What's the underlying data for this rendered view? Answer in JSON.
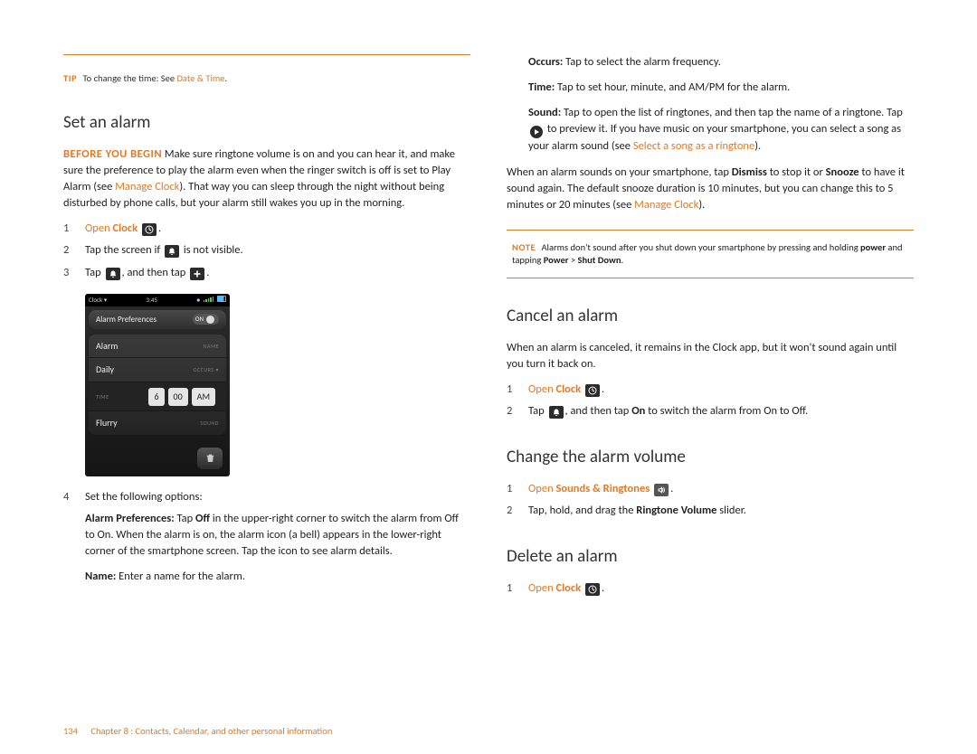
{
  "tip": {
    "label": "TIP",
    "text_before": "To change the time: See ",
    "link": "Date & Time",
    "text_after": "."
  },
  "left": {
    "heading": "Set an alarm",
    "before_begin_label": "BEFORE YOU BEGIN",
    "before_begin_text1": " Make sure ringtone volume is on and you can hear it, and make sure the preference to play the alarm even when the ringer switch is off is set to Play Alarm (see ",
    "before_begin_link": "Manage Clock",
    "before_begin_text2": "). That way you can sleep through the night without being disturbed by phone calls, but your alarm still wakes you up in the morning.",
    "step1_open": "Open ",
    "step1_app": "Clock",
    "step2_a": "Tap the screen if ",
    "step2_b": " is not visible.",
    "step3_a": "Tap ",
    "step3_b": ", and then tap ",
    "step3_c": ".",
    "step4": "Set the following options:",
    "opt_pref_label": "Alarm Preferences:",
    "opt_pref_text": " Tap Off in the upper-right corner to switch the alarm from Off to On. When the alarm is on, the alarm icon (a bell) appears in the lower-right corner of the smartphone screen. Tap the icon to see alarm details.",
    "opt_name_label": "Name:",
    "opt_name_text": " Enter a name for the alarm."
  },
  "screenshot": {
    "status_left": "Clock",
    "status_time": "3:45",
    "pref": "Alarm Preferences",
    "on": "ON",
    "alarm": "Alarm",
    "name_label": "NAME",
    "daily": "Daily",
    "occurs_label": "OCCURS",
    "time_label": "TIME",
    "h": "6",
    "m": "00",
    "ampm": "AM",
    "flurry": "Flurry",
    "sound_label": "SOUND"
  },
  "right": {
    "occurs_label": "Occurs:",
    "occurs_text": " Tap to select the alarm frequency.",
    "time_label": "Time:",
    "time_text": " Tap to set hour, minute, and AM/PM for the alarm.",
    "sound_label": "Sound:",
    "sound_text1": " Tap to open the list of ringtones, and then tap the name of a ringtone. Tap ",
    "sound_text2": " to preview it. If you have music on your smartphone, you can select a song as your alarm sound (see ",
    "sound_link": "Select a song as a ringtone",
    "sound_text3": ").",
    "dismiss_a": "When an alarm sounds on your smartphone, tap ",
    "dismiss_b": "Dismiss",
    "dismiss_c": " to stop it or ",
    "dismiss_d": "Snooze",
    "dismiss_e": " to have it sound again. The default snooze duration is 10 minutes, but you can change this to 5 minutes or 20 minutes (see ",
    "dismiss_link": "Manage Clock",
    "dismiss_f": ").",
    "note_label": "NOTE",
    "note_text1": "Alarms don't sound after you shut down your smartphone by pressing and holding ",
    "note_b1": "power",
    "note_text2": " and tapping ",
    "note_b2": "Power",
    "note_text3": " > ",
    "note_b3": "Shut Down",
    "note_text4": ".",
    "cancel_heading": "Cancel an alarm",
    "cancel_p": "When an alarm is canceled, it remains in the Clock app, but it won't sound again until you turn it back on.",
    "cancel_step1_open": "Open ",
    "cancel_step1_app": "Clock",
    "cancel_step2_a": "Tap ",
    "cancel_step2_b": ", and then tap ",
    "cancel_step2_c": "On",
    "cancel_step2_d": " to switch the alarm from On to Off.",
    "volume_heading": "Change the alarm volume",
    "volume_step1_open": "Open ",
    "volume_step1_app": "Sounds & Ringtones",
    "volume_step2_a": "Tap, hold, and drag the ",
    "volume_step2_b": "Ringtone Volume",
    "volume_step2_c": " slider.",
    "delete_heading": "Delete an alarm",
    "delete_step1_open": "Open ",
    "delete_step1_app": "Clock"
  },
  "footer": {
    "page": "134",
    "chapter": "Chapter 8 : Contacts, Calendar, and other personal information"
  }
}
